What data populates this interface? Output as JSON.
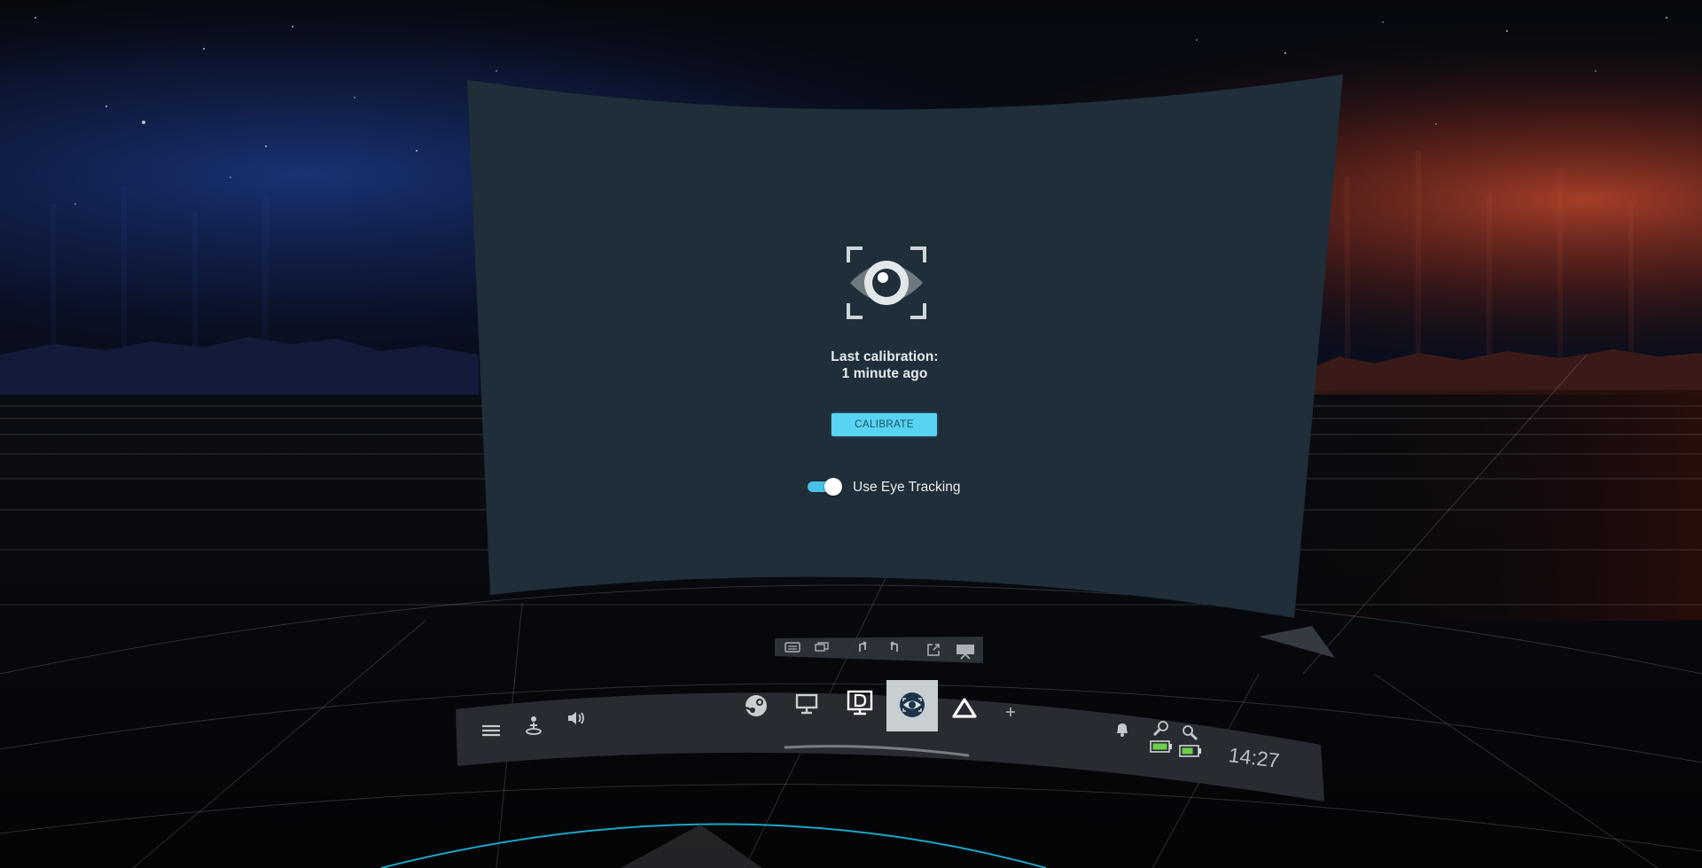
{
  "eye_tracking_panel": {
    "eye_icon": "eye-calibration-icon",
    "last_calibration_label": "Last calibration:",
    "last_calibration_value": "1 minute ago",
    "calibrate_button_label": "CALIBRATE",
    "use_eye_tracking_label": "Use Eye Tracking",
    "use_eye_tracking_enabled": true
  },
  "overlay_controls": [
    {
      "icon": "keyboard-icon"
    },
    {
      "icon": "windows-icon"
    },
    {
      "icon": "rotate-icon"
    },
    {
      "icon": "rotate-back-icon"
    },
    {
      "icon": "open-external-icon"
    },
    {
      "icon": "desktop-view-icon"
    }
  ],
  "dashboard": {
    "left_buttons": [
      {
        "icon": "menu-icon"
      },
      {
        "icon": "room-setup-icon"
      },
      {
        "icon": "volume-icon"
      }
    ],
    "app_buttons": [
      {
        "icon": "steam-icon"
      },
      {
        "icon": "desktop-icon"
      },
      {
        "icon": "display-d-icon"
      },
      {
        "icon": "eye-tracking-app-icon",
        "selected": true
      },
      {
        "icon": "vive-icon"
      },
      {
        "icon": "plus-icon"
      }
    ],
    "right_status": [
      {
        "icon": "notification-bell-icon"
      },
      {
        "icon": "controller-left-icon"
      },
      {
        "icon": "controller-right-icon"
      },
      {
        "icon": "battery-left-icon"
      },
      {
        "icon": "battery-right-icon"
      }
    ],
    "time": "14:27"
  },
  "colors": {
    "panel_bg": "#1f2e38",
    "accent": "#58d3f3",
    "toggle_on": "#46c2e6",
    "battery": "#6cd04a",
    "selected_tab": "#c9ced3"
  }
}
